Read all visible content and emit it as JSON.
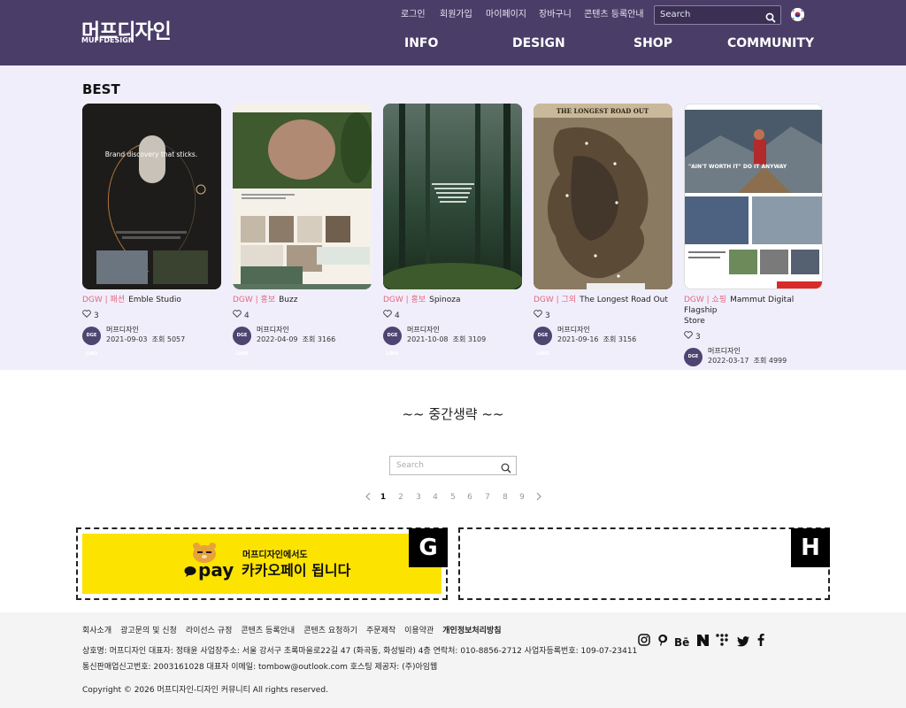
{
  "header": {
    "logo_kr": "머프디자인",
    "logo_en": "MUFFDESIGN",
    "top_links": [
      "로그인",
      "회원가입",
      "마이페이지",
      "장바구니",
      "콘텐츠 등록안내"
    ],
    "search_placeholder": "Search",
    "main_nav": [
      "INFO",
      "DESIGN",
      "SHOP",
      "COMMUNITY"
    ]
  },
  "best": {
    "title": "BEST",
    "cards": [
      {
        "category": "DGW | 패션",
        "title": "Emble Studio",
        "likes": "3",
        "author": "머프디자인",
        "date": "2021-09-03",
        "views": "조회 5057",
        "thumb_text": "Brand discovery that sticks."
      },
      {
        "category": "DGW | 홍보",
        "title": "Buzz",
        "likes": "4",
        "author": "머프디자인",
        "date": "2022-04-09",
        "views": "조회 3166",
        "thumb_text": ""
      },
      {
        "category": "DGW | 홍보",
        "title": "Spinoza",
        "likes": "4",
        "author": "머프디자인",
        "date": "2021-10-08",
        "views": "조회 3109",
        "thumb_text": ""
      },
      {
        "category": "DGW | 그외",
        "title": "The Longest Road Out",
        "likes": "3",
        "author": "머프디자인",
        "date": "2021-09-16",
        "views": "조회 3156",
        "thumb_text": "THE LONGEST ROAD OUT"
      },
      {
        "category": "DGW | 쇼핑",
        "title": "Mammut Digital Flagship",
        "title2": "Store",
        "likes": "3",
        "author": "머프디자인",
        "date": "2022-03-17",
        "views": "조회 4999",
        "thumb_text": "\"AIN'T WORTH IT\" DO IT ANYWAY"
      }
    ],
    "avatar_text": "DGE LINO"
  },
  "omitted_text": "~~ 중간생략 ~~",
  "search": {
    "placeholder": "Search"
  },
  "pagination": [
    "1",
    "2",
    "3",
    "4",
    "5",
    "6",
    "7",
    "8",
    "9"
  ],
  "ads": {
    "left_letter": "G",
    "right_letter": "H",
    "kakao_pay": "pay",
    "kakao_line1": "머프디자인에서도",
    "kakao_line2": "카카오페이 됩니다"
  },
  "footer": {
    "links": [
      "회사소개",
      "광고문의 및 신청",
      "라이선스 규정",
      "콘텐츠 등록안내",
      "콘텐츠 요청하기",
      "주문제작",
      "이용약관",
      "개인정보처리방침"
    ],
    "info_line1": "상호명: 머프디자인   대표자: 정태윤   사업장주소: 서울 강서구 초록마을로22길 47 (화곡동, 화성빌라) 4층   연락처: 010-8856-2712   사업자등록번호: 109-07-23411",
    "info_line2": "통신판매업신고번호: 2003161028   대표자 이메일: tombow@outlook.com   호스팅 제공자: (주)아임웹",
    "copyright": "Copyright © 2026 머프디자인-디자인 커뮤니티 All rights reserved.",
    "social_icons": [
      "instagram-icon",
      "pinterest-icon",
      "behance-icon",
      "naver-icon",
      "dots-icon",
      "twitter-icon",
      "facebook-icon"
    ]
  },
  "colors": {
    "header_bg": "#4a3d68",
    "best_bg": "#f1eefc",
    "category": "#e4677c",
    "kakao_yellow": "#fde400"
  }
}
